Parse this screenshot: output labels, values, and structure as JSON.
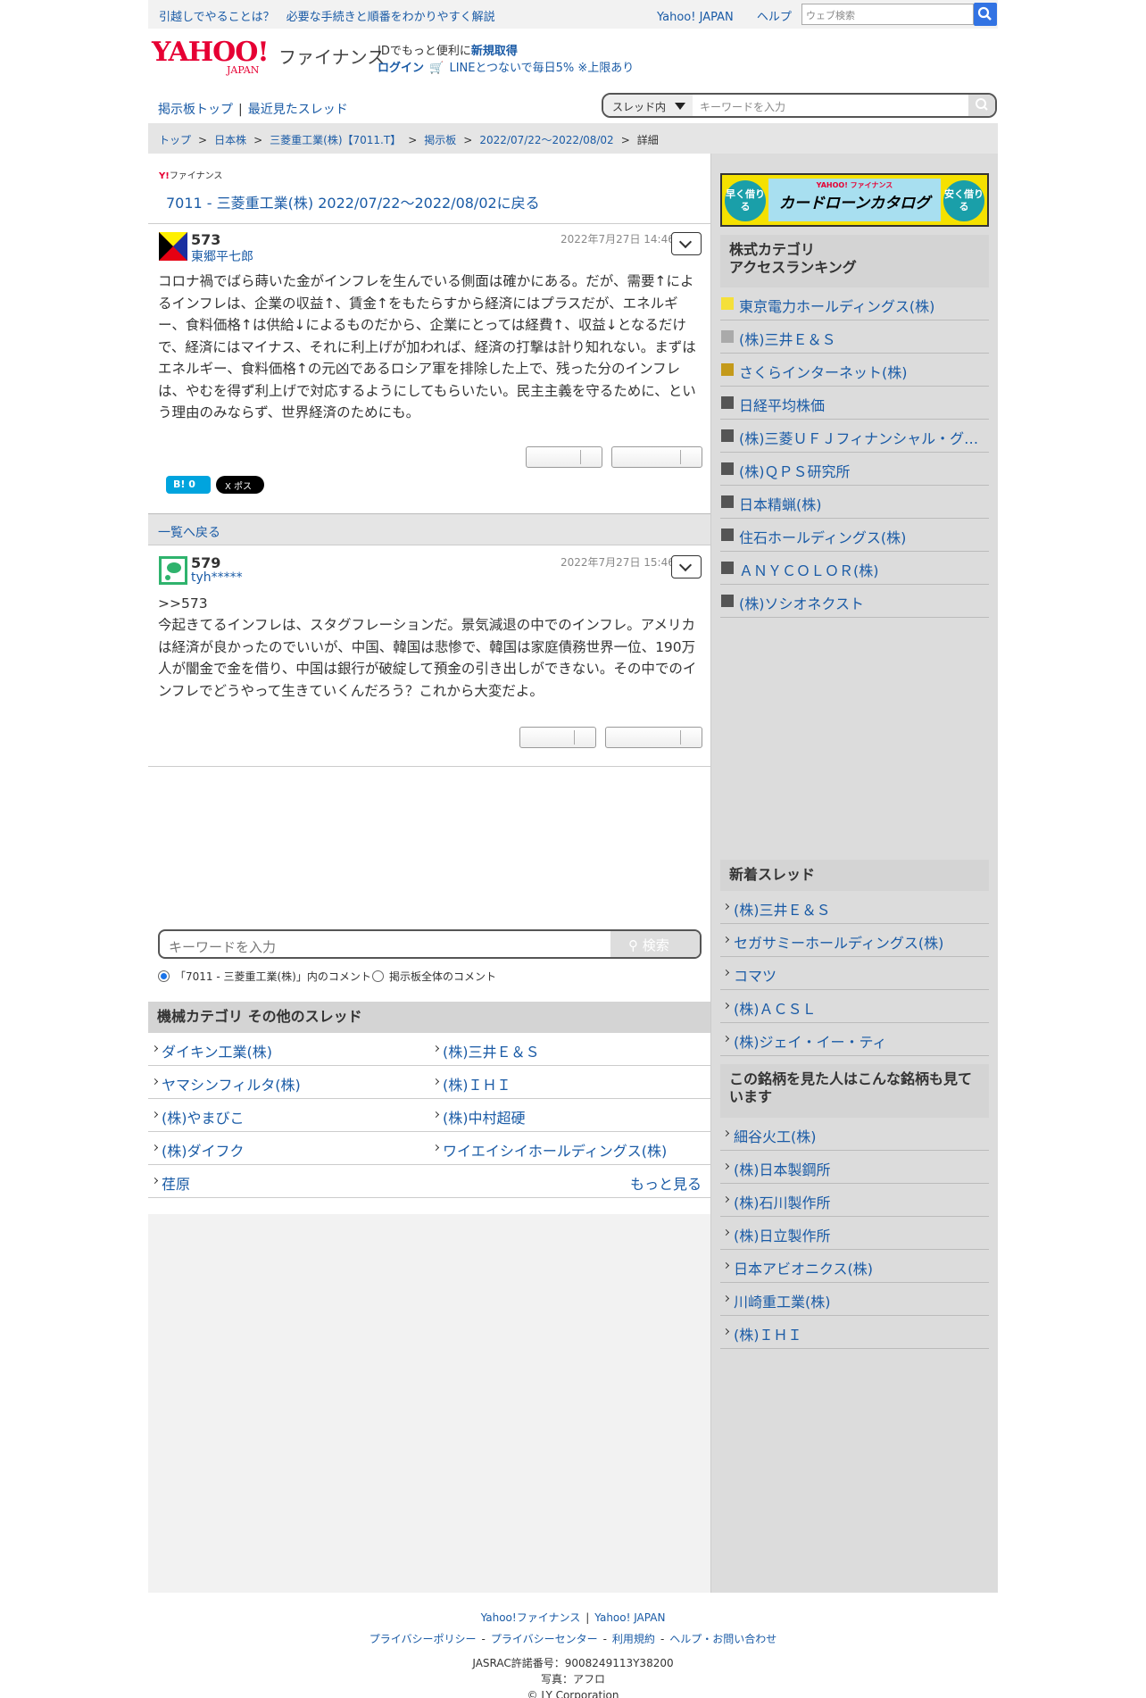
{
  "topbar": {
    "promo": "引越しでやることは？　必要な手続きと順番をわかりやすく解説",
    "links": [
      "Yahoo! JAPAN",
      "ヘルプ"
    ],
    "search_placeholder": "ウェブ検索"
  },
  "header": {
    "logo_text": "YAHOO!",
    "logo_sub": "JAPAN",
    "service": "ファイナンス",
    "promo_line1_prefix": "IDでもっと便利に",
    "promo_line1_link": "新規取得",
    "login": "ログイン",
    "line_promo": "LINEとつないで毎日5% ※上限あり"
  },
  "subnav": {
    "board_top": "掲示板トップ",
    "sep": "|",
    "recent": "最近見たスレッド"
  },
  "thread_search": {
    "scope": "スレッド内",
    "placeholder": "キーワードを入力"
  },
  "breadcrumb": {
    "items": [
      "トップ",
      "日本株",
      "三菱重工業(株)【7011.T】",
      "掲示板",
      "2022/07/22〜2022/08/02"
    ],
    "current": "詳細",
    "sep": ">"
  },
  "thread": {
    "brand_y": "Y!",
    "brand": "ファイナンス",
    "back_link": "7011 - 三菱重工業(株) 2022/07/22〜2022/08/02に戻る"
  },
  "posts": [
    {
      "number": "573",
      "user": "東郷平七郎",
      "date": "2022年7月27日 14:46",
      "body": "コロナ禍でばら蒔いた金がインフレを生んでいる側面は確かにある。だが、需要↑によるインフレは、企業の収益↑、賃金↑をもたらすから経済にはプラスだが、エネルギー、食料価格↑は供給↓によるものだから、企業にとっては経費↑、収益↓となるだけで、経済にはマイナス、それに利上げが加われば、経済の打撃は計り知れない。まずはエネルギー、食料価格↑の元凶であるロシア軍を排除した上で、残った分のインフレは、やむを得ず利上げで対応するようにしてもらいたい。民主主義を守るために、という理由のみならず、世界経済のためにも。"
    },
    {
      "number": "579",
      "user": "tyh*****",
      "date": "2022年7月27日 15:46",
      "body_reply": ">>573",
      "body": "今起きてるインフレは、スタグフレーションだ。景気減退の中でのインフレ。アメリカは経済が良かったのでいいが、中国、韓国は悲惨で、韓国は家庭債務世界一位、190万人が闇金で金を借り、中国は銀行が破綻して預金の引き出しができない。その中でのインフレでどうやって生きていくんだろう？これから大変だよ。"
    }
  ],
  "share": {
    "hatena": "B! 0",
    "x": "X ポスト"
  },
  "list_back": "一覧へ戻る",
  "keyword_search": {
    "placeholder": "キーワードを入力",
    "button": "検索",
    "option_thread": "「7011 - 三菱重工業(株)」内のコメント",
    "option_all": "掲示板全体のコメント"
  },
  "category": {
    "title": "機械カテゴリ  その他のスレッド",
    "left": [
      "ダイキン工業(株)",
      "ヤマシンフィルタ(株)",
      "(株)やまびこ",
      "(株)ダイフク",
      "荏原"
    ],
    "right": [
      "(株)三井Ｅ＆Ｓ",
      "(株)ＩＨＩ",
      "(株)中村超硬",
      "ワイエイシイホールディングス(株)"
    ],
    "more": "もっと見る"
  },
  "sidebar": {
    "banner": {
      "left": "早く借りる",
      "brand": "YAHOO! ファイナンス",
      "title": "カードローンカタログ",
      "right": "安く借りる"
    },
    "ranking_title_1": "株式カテゴリ",
    "ranking_title_2": "アクセスランキング",
    "ranking": [
      {
        "name": "東京電力ホールディングス(株)",
        "color": "#f5e03a"
      },
      {
        "name": "(株)三井Ｅ＆Ｓ",
        "color": "#aaaaaa"
      },
      {
        "name": "さくらインターネット(株)",
        "color": "#c49a1a"
      },
      {
        "name": "日経平均株価",
        "color": "#555555"
      },
      {
        "name": "(株)三菱ＵＦＪフィナンシャル・グ…",
        "color": "#555555"
      },
      {
        "name": "(株)ＱＰＳ研究所",
        "color": "#555555"
      },
      {
        "name": "日本精蝋(株)",
        "color": "#555555"
      },
      {
        "name": "住石ホールディングス(株)",
        "color": "#555555"
      },
      {
        "name": "ＡＮＹＣＯＬＯＲ(株)",
        "color": "#555555"
      },
      {
        "name": "(株)ソシオネクスト",
        "color": "#555555"
      }
    ],
    "new_threads_title": "新着スレッド",
    "new_threads": [
      "(株)三井Ｅ＆Ｓ",
      "セガサミーホールディングス(株)",
      "コマツ",
      "(株)ＡＣＳＬ",
      "(株)ジェイ・イー・ティ"
    ],
    "also_viewed_title": "この銘柄を見た人はこんな銘柄も見ています",
    "also_viewed": [
      "細谷火工(株)",
      "(株)日本製鋼所",
      "(株)石川製作所",
      "(株)日立製作所",
      "日本アビオニクス(株)",
      "川崎重工業(株)",
      "(株)ＩＨＩ"
    ]
  },
  "footer": {
    "links1": [
      "Yahoo!ファイナンス",
      "Yahoo! JAPAN"
    ],
    "links2": [
      "プライバシーポリシー",
      "プライバシーセンター",
      "利用規約",
      "ヘルプ・お問い合わせ"
    ],
    "jasrac": "JASRAC許諾番号：9008249113Y38200",
    "photo": "写真：アフロ",
    "copyright": "© LY Corporation"
  }
}
